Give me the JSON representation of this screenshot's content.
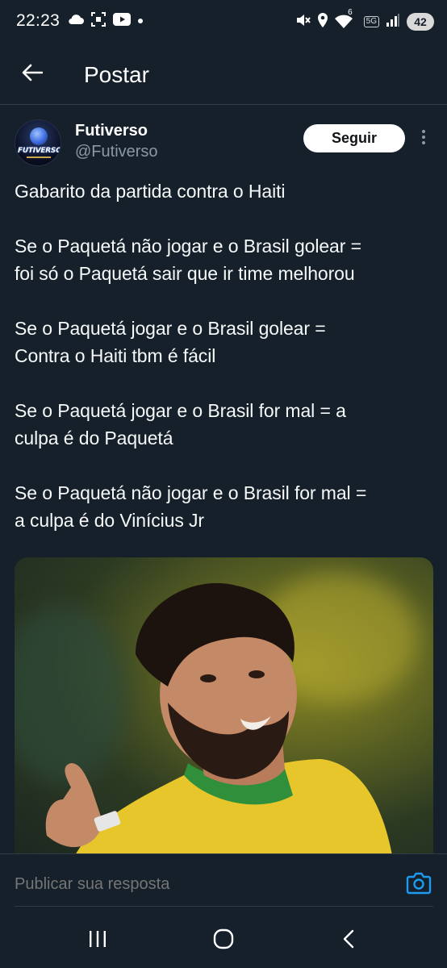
{
  "status_bar": {
    "time": "22:23",
    "left_icons": [
      "cloud-icon",
      "screenshot-icon",
      "youtube-icon",
      "dot-icon"
    ],
    "right_icons": [
      "mute-icon",
      "location-icon",
      "wifi-icon",
      "5g-icon",
      "signal-icon"
    ],
    "wifi_sup": "6",
    "network_tag": "5G",
    "battery": "42"
  },
  "header": {
    "back_icon": "arrow-left-icon",
    "title": "Postar"
  },
  "post": {
    "author": {
      "name": "Futiverso",
      "handle": "@Futiverso",
      "avatar_text": "FUTIVERSO"
    },
    "follow_label": "Seguir",
    "more_icon": "more-vertical-icon",
    "lines": [
      "Gabarito da partida contra o Haiti",
      "",
      "Se o Paquetá não jogar e o Brasil golear =",
      "foi só o Paquetá sair que ir time melhorou",
      "",
      "Se o Paquetá jogar e o Brasil golear =",
      "Contra o Haiti tbm é fácil",
      "",
      "Se o Paquetá jogar e o Brasil for mal = a",
      "culpa é do Paquetá",
      "",
      "Se o Paquetá não jogar e o Brasil for mal =",
      "a culpa é do Vinícius Jr"
    ]
  },
  "reply": {
    "placeholder": "Publicar sua resposta",
    "camera_icon": "camera-icon"
  },
  "nav": {
    "icons": [
      "recents-icon",
      "home-icon",
      "back-icon"
    ]
  },
  "colors": {
    "background": "#15202b",
    "text": "#f7f9f9",
    "secondary_text": "#8b98a5",
    "accent": "#1d9bf0",
    "divider": "#2f3b46"
  }
}
